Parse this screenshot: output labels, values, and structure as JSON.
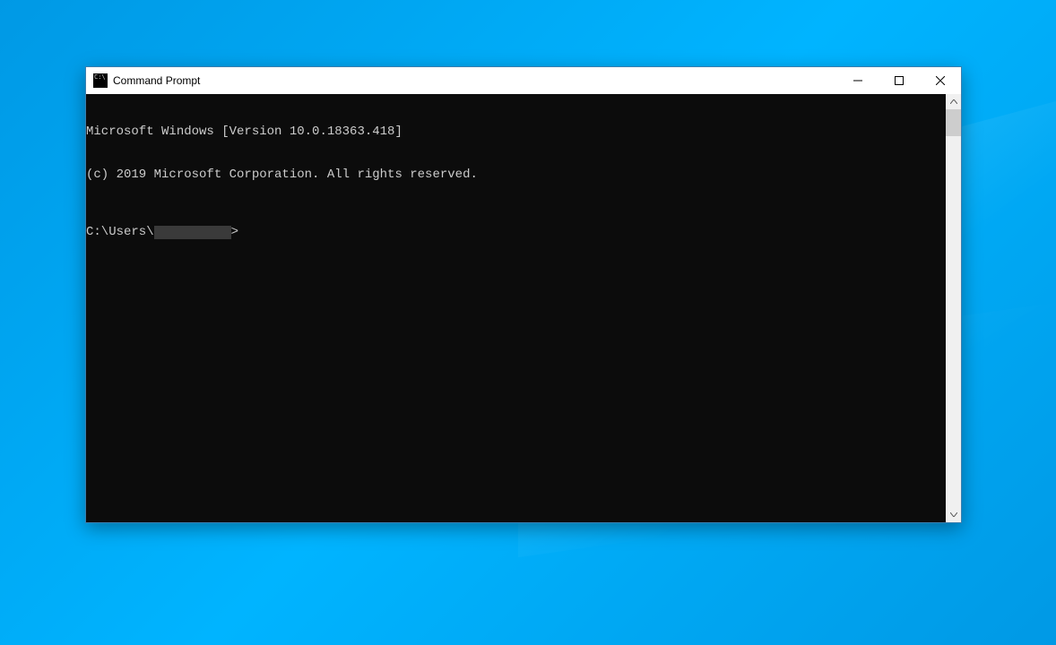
{
  "window": {
    "title": "Command Prompt"
  },
  "terminal": {
    "line1": "Microsoft Windows [Version 10.0.18363.418]",
    "line2": "(c) 2019 Microsoft Corporation. All rights reserved.",
    "prompt_prefix": "C:\\Users\\",
    "prompt_suffix": ">"
  }
}
